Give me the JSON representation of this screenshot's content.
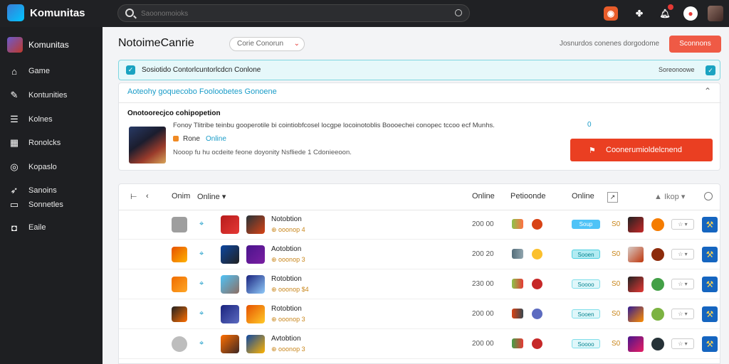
{
  "app": {
    "title": "Komunitas"
  },
  "search": {
    "placeholder": "Saoonomoioks"
  },
  "sidebar": {
    "brand": "Komunitas",
    "items": [
      {
        "label": "Game",
        "icon": "home-icon"
      },
      {
        "label": "Kontunities",
        "icon": "tools-icon"
      },
      {
        "label": "Kolnes",
        "icon": "list-icon"
      },
      {
        "label": "Ronolcks",
        "icon": "grid-icon"
      },
      {
        "label": "Kopaslo",
        "icon": "disc-icon"
      },
      {
        "label": "Sanoins",
        "icon": "rocket-icon"
      },
      {
        "label": "Sonnetles",
        "icon": "card-icon"
      },
      {
        "label": "Eaile",
        "icon": "chat-icon"
      }
    ]
  },
  "header": {
    "title": "NotoimeCanrie",
    "filter": "Corie Conorun",
    "note": "Josnurdos conenes dorgodome",
    "button": "Sconnons"
  },
  "alert": {
    "text": "Sosiotido Contorlcuntorlcdcn Conlone",
    "right_label": "Soreonoowe"
  },
  "panel": {
    "header": "Aoteohy goquecobo Fooloobetes Gonoene",
    "title": "Onotoorecjco cohipopetion",
    "description": "Fonoy Tlitribe teinbu gooperotile bi cointiobfcosel locgpe locoinotoblis Boooechei conopec tccoo ecf Munhs.",
    "description_num": "0",
    "tag1": "Rone",
    "tag2": "Online",
    "meta": "Nooop fu hu ocdeite feone doyonity Nsfliede 1 Cdonieeoon.",
    "cta": "Coonerumioldelcnend"
  },
  "table": {
    "headers": [
      "Onim",
      "Online",
      "Online",
      "Petioonde",
      "Online",
      "Ikop"
    ],
    "rows": [
      {
        "link": "⌖",
        "name": "Notobtion",
        "sub": "⊕ ooonop 4",
        "score": "200 00",
        "pill": "Soup",
        "pill_color": "#4fc3f7",
        "num": "S0",
        "sel": "☆ ▾"
      },
      {
        "link": "⌖",
        "name": "Aotobtion",
        "sub": "⊕ ooonop 3",
        "score": "200 20",
        "pill": "Sooen",
        "pill_color": "#b2ebf2",
        "num": "S0",
        "sel": "☆ ▾"
      },
      {
        "link": "⌖",
        "name": "Rotobtion",
        "sub": "⊕ ooonop $4",
        "score": "230 00",
        "pill": "Soooo",
        "pill_color": "#e0f7fa",
        "num": "S0",
        "sel": "☆ ▾"
      },
      {
        "link": "⌖",
        "name": "Rotobtion",
        "sub": "⊕ ooonop 3",
        "score": "200 00",
        "pill": "Sooen",
        "pill_color": "#e0f7fa",
        "num": "S0",
        "sel": "☆ ▾"
      },
      {
        "link": "⌖",
        "name": "Avtobtion",
        "sub": "⊕ ooonop 3",
        "score": "200 00",
        "pill": "Soooo",
        "pill_color": "#e0f7fa",
        "num": "S0",
        "sel": "☆ ▾"
      }
    ]
  },
  "colors": {
    "accent": "#1a9cc8",
    "cta": "#ea3f22",
    "sidebar": "#1e1f22",
    "topbar": "#202124"
  }
}
